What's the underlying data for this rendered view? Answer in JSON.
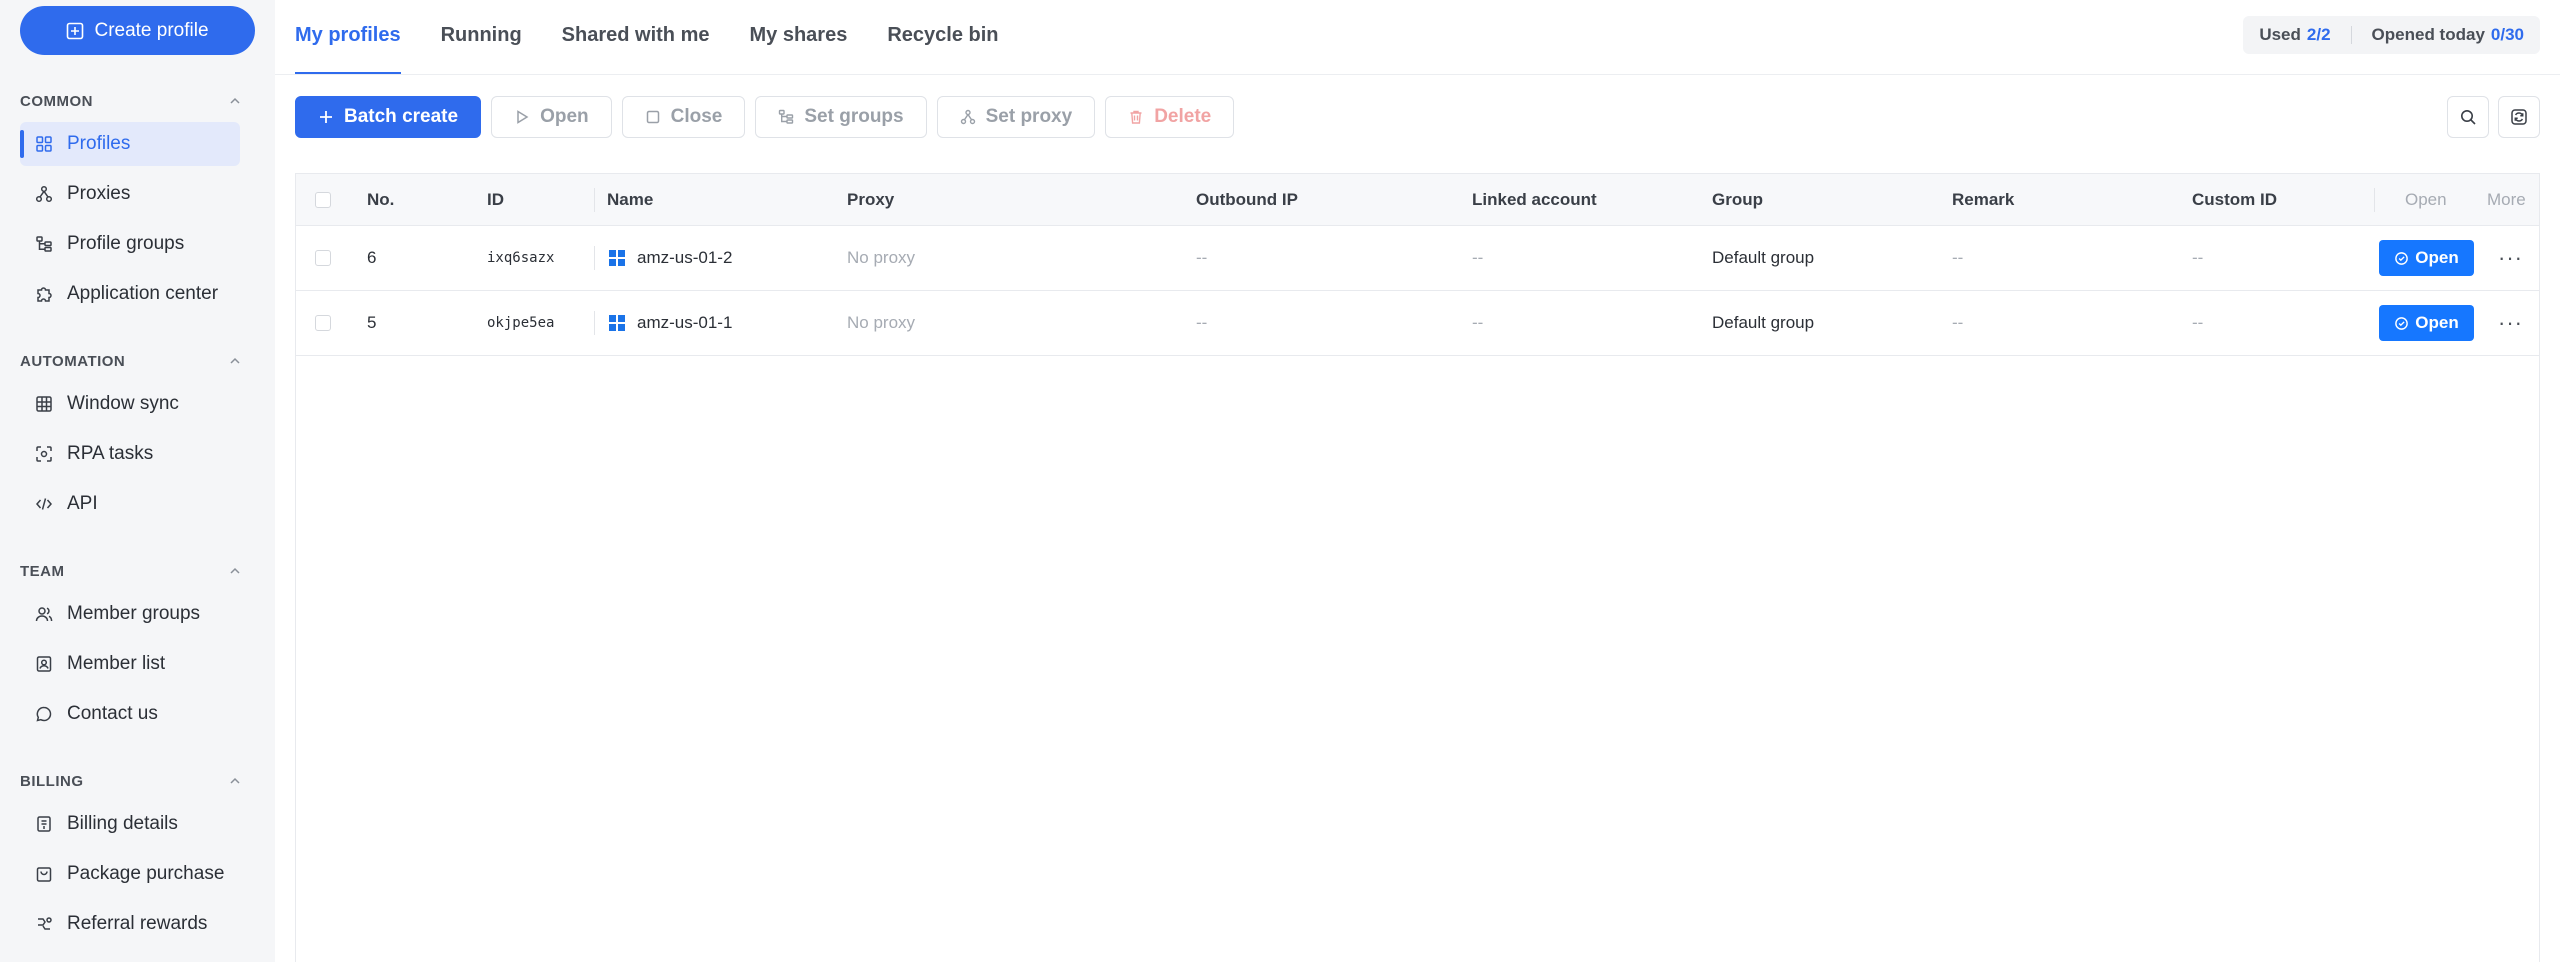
{
  "sidebar": {
    "create_label": "Create profile",
    "sections": [
      {
        "title": "COMMON",
        "items": [
          "Profiles",
          "Proxies",
          "Profile groups",
          "Application center"
        ]
      },
      {
        "title": "AUTOMATION",
        "items": [
          "Window sync",
          "RPA tasks",
          "API"
        ]
      },
      {
        "title": "TEAM",
        "items": [
          "Member groups",
          "Member list",
          "Contact us"
        ]
      },
      {
        "title": "BILLING",
        "items": [
          "Billing details",
          "Package purchase",
          "Referral rewards"
        ]
      }
    ]
  },
  "tabs": [
    "My profiles",
    "Running",
    "Shared with me",
    "My shares",
    "Recycle bin"
  ],
  "usage": {
    "used_label": "Used",
    "used_value": "2/2",
    "opened_label": "Opened today",
    "opened_value": "0/30"
  },
  "toolbar": {
    "batch_create": "Batch create",
    "open": "Open",
    "close": "Close",
    "set_groups": "Set groups",
    "set_proxy": "Set proxy",
    "delete": "Delete"
  },
  "table": {
    "headers": {
      "no": "No.",
      "id": "ID",
      "name": "Name",
      "proxy": "Proxy",
      "outbound_ip": "Outbound IP",
      "linked_account": "Linked account",
      "group": "Group",
      "remark": "Remark",
      "custom_id": "Custom ID",
      "open": "Open",
      "more": "More"
    },
    "rows": [
      {
        "no": "6",
        "id": "ixq6sazx",
        "name": "amz-us-01-2",
        "proxy": "No proxy",
        "outbound_ip": "--",
        "linked_account": "--",
        "group": "Default group",
        "remark": "--",
        "custom_id": "--",
        "open_label": "Open"
      },
      {
        "no": "5",
        "id": "okjpe5ea",
        "name": "amz-us-01-1",
        "proxy": "No proxy",
        "outbound_ip": "--",
        "linked_account": "--",
        "group": "Default group",
        "remark": "--",
        "custom_id": "--",
        "open_label": "Open"
      }
    ]
  },
  "colors": {
    "accent": "#2f6bed",
    "open_button": "#1677ff",
    "danger": "#f1a3a3"
  }
}
